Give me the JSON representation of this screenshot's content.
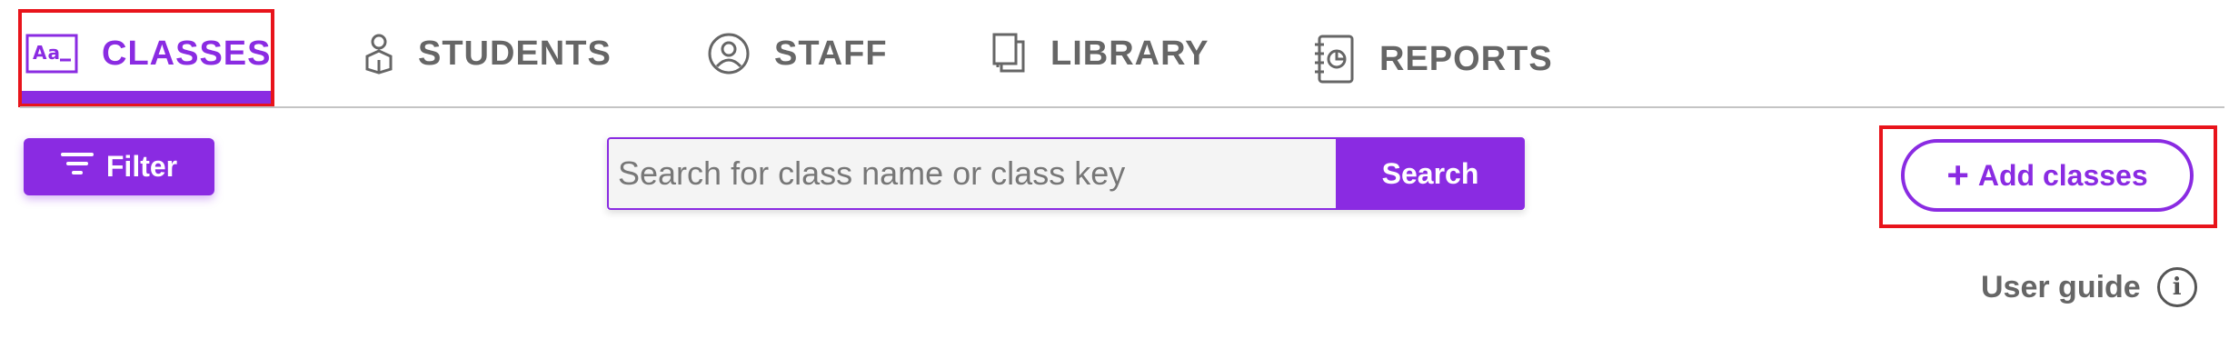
{
  "nav": {
    "tabs": [
      {
        "label": "CLASSES",
        "icon": "classes-icon",
        "active": true
      },
      {
        "label": "STUDENTS",
        "icon": "student-icon",
        "active": false
      },
      {
        "label": "STAFF",
        "icon": "staff-icon",
        "active": false
      },
      {
        "label": "LIBRARY",
        "icon": "library-icon",
        "active": false
      },
      {
        "label": "REPORTS",
        "icon": "reports-icon",
        "active": false
      }
    ]
  },
  "toolbar": {
    "filter_label": "Filter",
    "search_placeholder": "Search for class name or class key",
    "search_value": "",
    "search_button": "Search",
    "add_button": "Add classes",
    "add_prefix": "+"
  },
  "help": {
    "user_guide_label": "User guide",
    "info_glyph": "i"
  },
  "colors": {
    "accent": "#8a2be2",
    "highlight": "#e8141b",
    "text_muted": "#666666"
  }
}
